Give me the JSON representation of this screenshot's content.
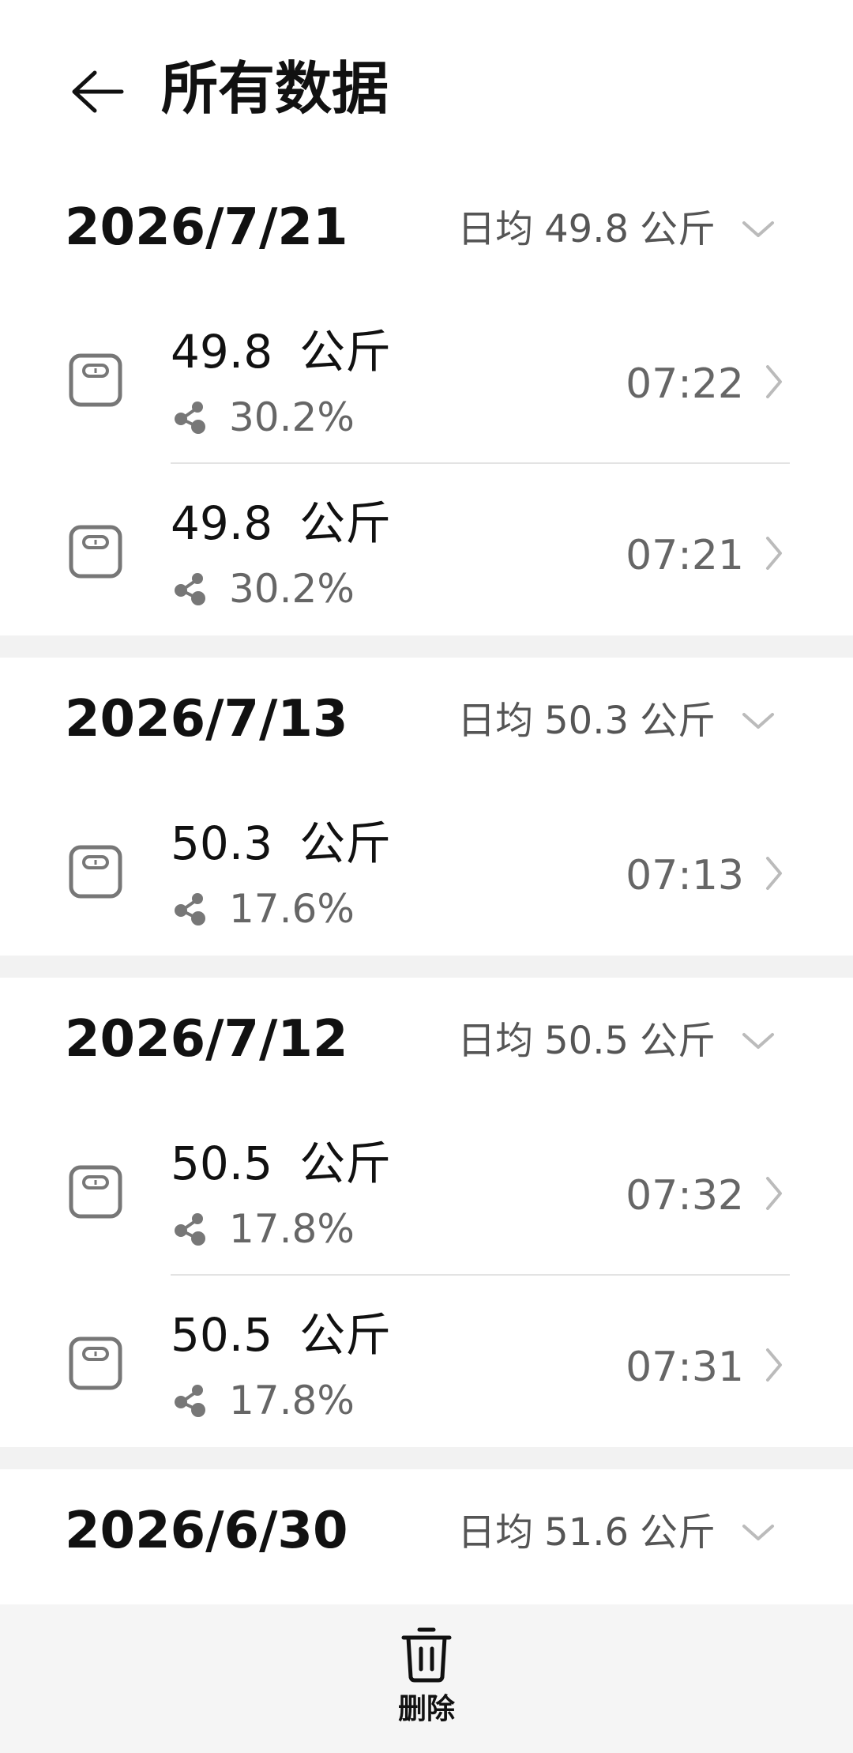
{
  "header": {
    "title": "所有数据"
  },
  "groups": [
    {
      "date": "2026/7/21",
      "avg_label": "日均",
      "avg_value": "49.8",
      "avg_unit": "公斤",
      "records": [
        {
          "weight": "49.8",
          "unit": "公斤",
          "fat": "30.2%",
          "time": "07:22"
        },
        {
          "weight": "49.8",
          "unit": "公斤",
          "fat": "30.2%",
          "time": "07:21"
        }
      ]
    },
    {
      "date": "2026/7/13",
      "avg_label": "日均",
      "avg_value": "50.3",
      "avg_unit": "公斤",
      "records": [
        {
          "weight": "50.3",
          "unit": "公斤",
          "fat": "17.6%",
          "time": "07:13"
        }
      ]
    },
    {
      "date": "2026/7/12",
      "avg_label": "日均",
      "avg_value": "50.5",
      "avg_unit": "公斤",
      "records": [
        {
          "weight": "50.5",
          "unit": "公斤",
          "fat": "17.8%",
          "time": "07:32"
        },
        {
          "weight": "50.5",
          "unit": "公斤",
          "fat": "17.8%",
          "time": "07:31"
        }
      ]
    },
    {
      "date": "2026/6/30",
      "avg_label": "日均",
      "avg_value": "51.6",
      "avg_unit": "公斤",
      "records": []
    }
  ],
  "bottom_bar": {
    "delete_label": "删除"
  },
  "icons": {
    "back": "arrow-left-icon",
    "expand": "chevron-down-icon",
    "scale": "scale-icon",
    "body_fat": "share-nodes-icon",
    "row_chevron": "chevron-right-icon",
    "delete": "trash-icon"
  }
}
